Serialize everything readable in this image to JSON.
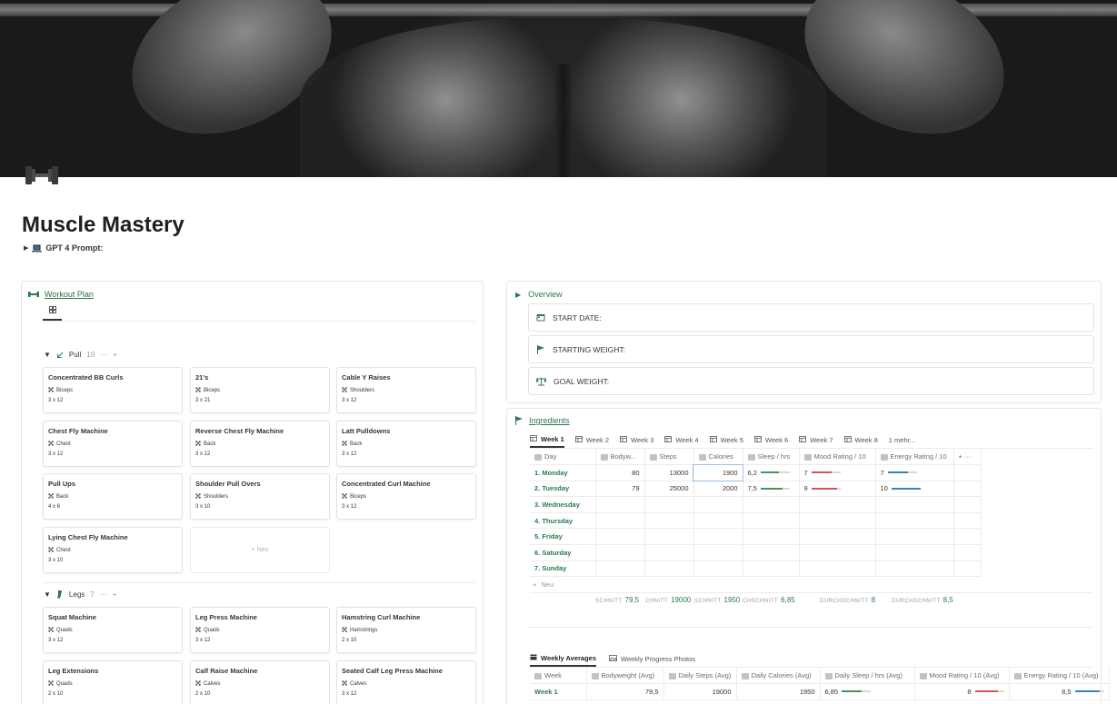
{
  "page": {
    "title": "Muscle Mastery",
    "prompt_toggle": "GPT 4 Prompt:"
  },
  "workout": {
    "title": "Workout Plan",
    "groups": [
      {
        "name": "Pull",
        "count": "10",
        "cards": [
          {
            "title": "Concentrated BB Curls",
            "tag": "Biceps",
            "sets": "3 x 12"
          },
          {
            "title": "21's",
            "tag": "Biceps",
            "sets": "3 x 21"
          },
          {
            "title": "Cable Y Raises",
            "tag": "Shoulders",
            "sets": "3 x 12"
          },
          {
            "title": "Chest Fly Machine",
            "tag": "Chest",
            "sets": "3 x 12"
          },
          {
            "title": "Reverse Chest Fly Machine",
            "tag": "Back",
            "sets": "3 x 12"
          },
          {
            "title": "Latt Pulldowns",
            "tag": "Back",
            "sets": "3 x 12"
          },
          {
            "title": "Pull Ups",
            "tag": "Back",
            "sets": "4 x 6"
          },
          {
            "title": "Shoulder Pull Overs",
            "tag": "Shoulders",
            "sets": "3 x 10"
          },
          {
            "title": "Concentrated Curl Machine",
            "tag": "Biceps",
            "sets": "3 x 12"
          },
          {
            "title": "Lying Chest Fly Machine",
            "tag": "Chest",
            "sets": "3 x 10"
          }
        ]
      },
      {
        "name": "Legs",
        "count": "7",
        "cards": [
          {
            "title": "Squat Machine",
            "tag": "Quads",
            "sets": "3 x 12"
          },
          {
            "title": "Leg Press Machine",
            "tag": "Quads",
            "sets": "3 x 12"
          },
          {
            "title": "Hamstring Curl Machine",
            "tag": "Hamstrings",
            "sets": "2 x 10"
          },
          {
            "title": "Leg Extensions",
            "tag": "Quads",
            "sets": "2 x 10"
          },
          {
            "title": "Calf Raise Machine",
            "tag": "Calves",
            "sets": "2 x 10"
          },
          {
            "title": "Seated Calf Leg Press Machine",
            "tag": "Calves",
            "sets": "3 x 12"
          }
        ]
      }
    ],
    "new_label": "Neu"
  },
  "overview": {
    "title": "Overview",
    "items": [
      "START DATE:",
      "STARTING WEIGHT:",
      "GOAL WEIGHT:"
    ]
  },
  "ingredients": {
    "title": "Ingredients",
    "tabs": [
      "Week 1",
      "Week 2",
      "Week 3",
      "Week 4",
      "Week 5",
      "Week 6",
      "Week 7",
      "Week 8",
      "1 mehr..."
    ],
    "columns": [
      "Day",
      "Bodyw...",
      "Steps",
      "Calories",
      "Sleep / hrs",
      "Mood Rating / 10",
      "Energy Rating / 10"
    ],
    "rows": [
      {
        "day": "1. Monday",
        "bodyweight": "80",
        "steps": "13000",
        "calories": "1900",
        "sleep": "6,2",
        "mood": "7",
        "energy": "7"
      },
      {
        "day": "2. Tuesday",
        "bodyweight": "79",
        "steps": "25000",
        "calories": "2000",
        "sleep": "7,5",
        "mood": "9",
        "energy": "10"
      },
      {
        "day": "3. Wednesday"
      },
      {
        "day": "4. Thursday"
      },
      {
        "day": "5. Friday"
      },
      {
        "day": "6. Saturday"
      },
      {
        "day": "7. Sunday"
      }
    ],
    "new_label": "Neu",
    "calc": [
      {
        "label": "SCHNITT",
        "value": "79,5"
      },
      {
        "label": "CHNITT",
        "value": "19000"
      },
      {
        "label": "SCHNITT",
        "value": "1950"
      },
      {
        "label": "CHSCHNITT",
        "value": "6,85"
      },
      {
        "label": "DURCHSCHNITT",
        "value": "8"
      },
      {
        "label": "DURCHSCHNITT",
        "value": "8,5"
      }
    ]
  },
  "weekly": {
    "tabs": [
      "Weekly Averages",
      "Weekly Progress Photos"
    ],
    "columns": [
      "Week",
      "Bodyweight (Avg)",
      "Daily Steps (Avg)",
      "Daily Calories (Avg)",
      "Daily Sleep / hrs (Avg)",
      "Mood Rating / 10 (Avg)",
      "Energy Rating / 10 (Avg)"
    ],
    "rows": [
      {
        "week": "Week 1",
        "bodyweight": "79,5",
        "steps": "19000",
        "calories": "1950",
        "sleep": "6,85",
        "mood": "8",
        "energy": "8,5"
      }
    ]
  },
  "colors": {
    "accent": "#2c7a4b",
    "sleep_bar": "#4a8f5d",
    "mood_bar": "#d9534f",
    "energy_bar": "#3b82b7"
  },
  "progress": {
    "sleep_1": 0.62,
    "sleep_2": 0.75,
    "mood_1": 0.7,
    "mood_2": 0.9,
    "energy_1": 0.7,
    "energy_2": 1.0,
    "avg_sleep": 0.685,
    "avg_mood": 0.8,
    "avg_energy": 0.85
  }
}
